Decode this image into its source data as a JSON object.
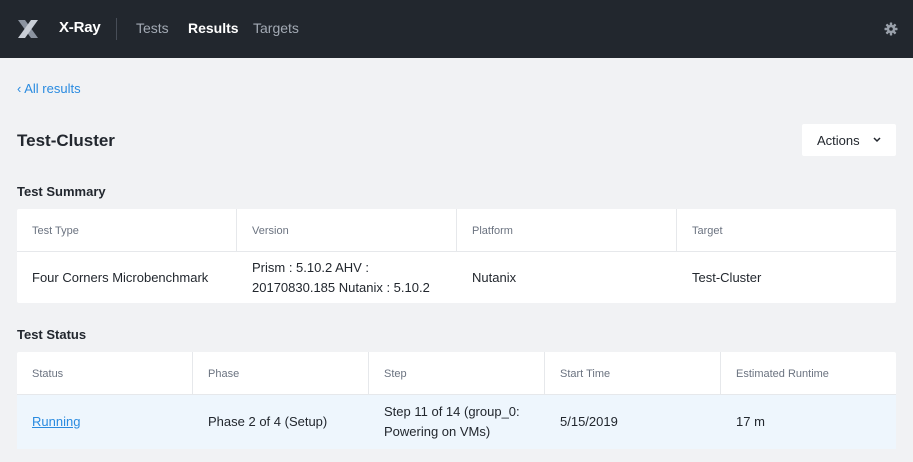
{
  "app": {
    "brand": "X-Ray"
  },
  "nav": {
    "tests": "Tests",
    "results": "Results",
    "targets": "Targets"
  },
  "icons": {
    "logo": "x-logo-icon",
    "settings": "gear-icon",
    "back": "chevron-left-icon",
    "dropdown": "chevron-down-icon"
  },
  "breadcrumb": {
    "back_label": "‹  All results"
  },
  "page": {
    "title": "Test-Cluster",
    "actions_label": "Actions"
  },
  "summary": {
    "section_title": "Test Summary",
    "headers": [
      "Test Type",
      "Version",
      "Platform",
      "Target"
    ],
    "row": {
      "test_type": "Four Corners Microbenchmark",
      "version_line1": "Prism : 5.10.2 AHV :",
      "version_line2": "20170830.185 Nutanix : 5.10.2",
      "platform": "Nutanix",
      "target": "Test-Cluster"
    }
  },
  "status": {
    "section_title": "Test Status",
    "headers": [
      "Status",
      "Phase",
      "Step",
      "Start Time",
      "Estimated Runtime"
    ],
    "row": {
      "status": "Running",
      "phase": "Phase 2 of 4 (Setup)",
      "step_line1": "Step 11 of 14 (group_0:",
      "step_line2": "Powering on VMs)",
      "start_time": "5/15/2019",
      "runtime": "17 m"
    }
  },
  "colors": {
    "topbar": "#22272e",
    "accent": "#2a8be0",
    "background": "#f1f2f4",
    "row_highlight": "#eef6fd"
  }
}
